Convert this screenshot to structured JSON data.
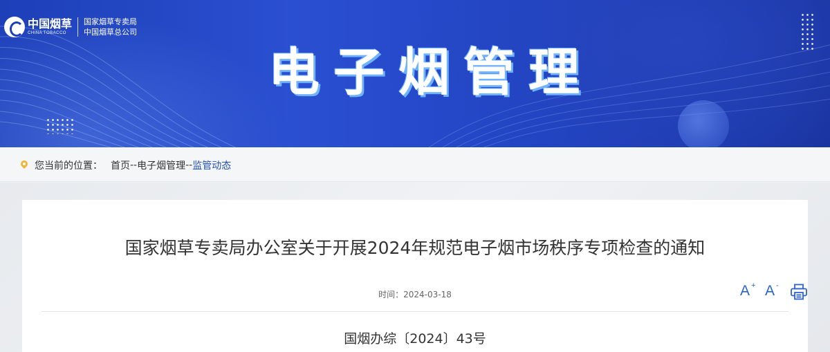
{
  "header": {
    "logo_brand": "中国烟草",
    "logo_english": "CHINA TOBACCO",
    "org_line1": "国家烟草专卖局",
    "org_line2": "中国烟草总公司",
    "channel_title": "电子烟管理"
  },
  "breadcrumb": {
    "label": "您当前的位置：",
    "items": [
      "首页",
      "电子烟管理",
      "监管动态"
    ],
    "separator": "--"
  },
  "article": {
    "title": "国家烟草专卖局办公室关于开展2024年规范电子烟市场秩序专项检查的通知",
    "time_label": "时间：",
    "date": "2024-03-18",
    "doc_number": "国烟办综〔2024〕43号"
  },
  "tools": {
    "font_increase_label": "A",
    "font_increase_sign": "+",
    "font_decrease_label": "A",
    "font_decrease_sign": "-",
    "print_icon": "print-icon"
  },
  "colors": {
    "banner_blue": "#1d3fb8",
    "accent_blue": "#2c63c9",
    "breadcrumb_current": "#2250b8",
    "pin_yellow": "#f2b53b"
  }
}
